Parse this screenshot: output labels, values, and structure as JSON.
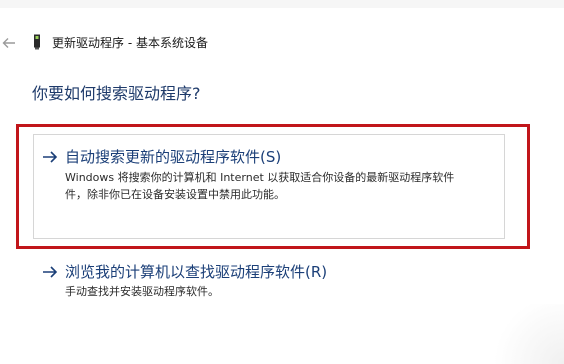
{
  "window": {
    "title": "更新驱动程序 - 基本系统设备"
  },
  "question": "你要如何搜索驱动程序?",
  "options": [
    {
      "title": "自动搜索更新的驱动程序软件(S)",
      "description_lines": [
        "Windows 将搜索你的计算机和 Internet 以获取适合你设备的最新驱动程序软件",
        "件，除非你已在设备安装设置中禁用此功能。"
      ],
      "highlighted": true
    },
    {
      "title": "浏览我的计算机以查找驱动程序软件(R)",
      "description_lines": [
        "手动查找并安装驱动程序软件。"
      ],
      "highlighted": false
    }
  ],
  "icons": {
    "back": "back-arrow-icon",
    "device": "device-icon",
    "option_arrow": "right-arrow-icon"
  },
  "colors": {
    "link": "#1b3f78",
    "question": "#1e3a6a",
    "highlight_border": "#c1151a",
    "card_border": "#d6d6d6"
  }
}
